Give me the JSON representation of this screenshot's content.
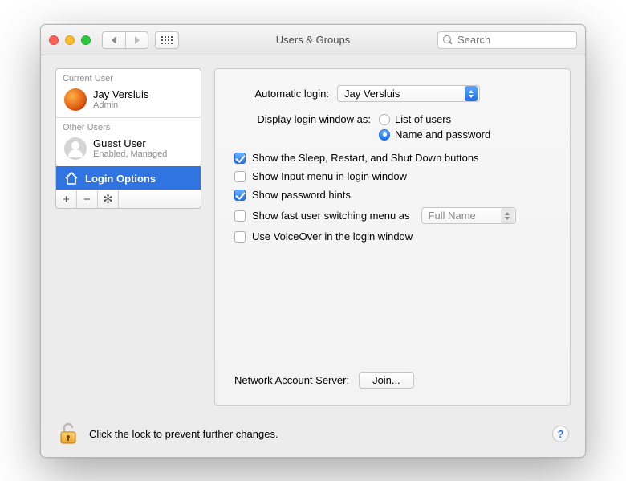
{
  "window": {
    "title": "Users & Groups"
  },
  "search": {
    "placeholder": "Search"
  },
  "sidebar": {
    "sections": [
      {
        "header": "Current User",
        "user": {
          "name": "Jay Versluis",
          "sub": "Admin"
        }
      },
      {
        "header": "Other Users",
        "user": {
          "name": "Guest User",
          "sub": "Enabled, Managed"
        }
      }
    ],
    "login_options": "Login Options"
  },
  "main": {
    "auto_login_label": "Automatic login:",
    "auto_login_value": "Jay Versluis",
    "display_login_label": "Display login window as:",
    "radio_list": "List of users",
    "radio_name": "Name and password",
    "check_sleep": "Show the Sleep, Restart, and Shut Down buttons",
    "check_input": "Show Input menu in login window",
    "check_hints": "Show password hints",
    "check_fast": "Show fast user switching menu as",
    "fast_value": "Full Name",
    "check_vo": "Use VoiceOver in the login window",
    "nas_label": "Network Account Server:",
    "join_label": "Join..."
  },
  "footer": {
    "lock_text": "Click the lock to prevent further changes."
  },
  "checked": {
    "radio_list": false,
    "radio_name": true,
    "sleep": true,
    "input": false,
    "hints": true,
    "fast": false,
    "vo": false
  }
}
